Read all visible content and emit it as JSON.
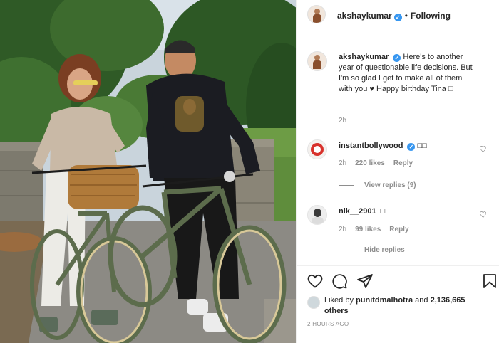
{
  "post": {
    "author": "akshaykumar",
    "follow_status": "Following",
    "caption_text": "Here's to another year of questionable life decisions. But I'm so glad I get to make all of them with you ♥ Happy birthday Tina □",
    "caption_age": "2h",
    "liked_by_prefix": "Liked by",
    "liked_by_user": "punitdmalhotra",
    "liked_by_and": "and",
    "liked_by_count": "2,136,665 others",
    "timestamp": "2 HOURS AGO"
  },
  "comments": [
    {
      "username": "instantbollywood",
      "verified": true,
      "text": "□□",
      "age": "2h",
      "likes": "220 likes",
      "reply_label": "Reply",
      "replies_toggle": "View replies (9)"
    },
    {
      "username": "nik__2901",
      "verified": false,
      "text": "□",
      "age": "2h",
      "likes": "99 likes",
      "reply_label": "Reply",
      "replies_toggle": "Hide replies"
    }
  ],
  "icons": {
    "verified": "verified-badge-icon",
    "like": "heart-icon",
    "comment": "comment-bubble-icon",
    "share": "paper-plane-icon",
    "save": "bookmark-icon",
    "comment_like": "heart-outline-icon"
  },
  "colors": {
    "verified_blue": "#3897f0",
    "secondary_text": "#8e8e8e",
    "primary_text": "#262626",
    "divider": "#efefef"
  }
}
